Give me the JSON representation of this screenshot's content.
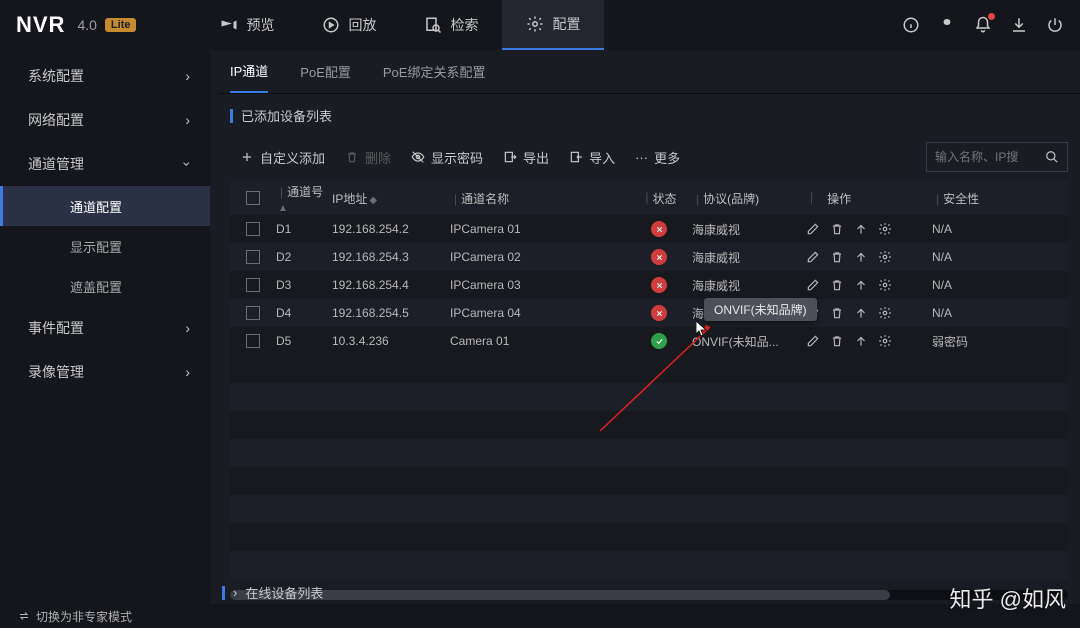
{
  "brand": {
    "name": "NVR",
    "version": "4.0",
    "edition": "Lite"
  },
  "mainnav": [
    {
      "label": "预览",
      "icon": "camera"
    },
    {
      "label": "回放",
      "icon": "playback"
    },
    {
      "label": "检索",
      "icon": "search-doc"
    },
    {
      "label": "配置",
      "icon": "gear",
      "active": true
    }
  ],
  "sidebar": [
    {
      "label": "系统配置",
      "expand": false
    },
    {
      "label": "网络配置",
      "expand": false
    },
    {
      "label": "通道管理",
      "expand": true,
      "children": [
        {
          "label": "通道配置",
          "active": true
        },
        {
          "label": "显示配置"
        },
        {
          "label": "遮盖配置"
        }
      ]
    },
    {
      "label": "事件配置",
      "expand": false
    },
    {
      "label": "录像管理",
      "expand": false
    }
  ],
  "subtabs": [
    {
      "label": "IP通道",
      "active": true
    },
    {
      "label": "PoE配置"
    },
    {
      "label": "PoE绑定关系配置"
    }
  ],
  "sections": {
    "added": "已添加设备列表",
    "online": "在线设备列表"
  },
  "toolbar": {
    "customAdd": "自定义添加",
    "delete": "删除",
    "showPwd": "显示密码",
    "export": "导出",
    "import": "导入",
    "more": "更多",
    "searchPlaceholder": "输入名称、IP搜"
  },
  "columns": {
    "channel": "通道号",
    "ip": "IP地址",
    "name": "通道名称",
    "status": "状态",
    "proto": "协议(品牌)",
    "ops": "操作",
    "sec": "安全性"
  },
  "rows": [
    {
      "ch": "D1",
      "ip": "192.168.254.2",
      "name": "IPCamera 01",
      "status": "err",
      "proto": "海康威视",
      "sec": "N/A"
    },
    {
      "ch": "D2",
      "ip": "192.168.254.3",
      "name": "IPCamera 02",
      "status": "err",
      "proto": "海康威视",
      "sec": "N/A"
    },
    {
      "ch": "D3",
      "ip": "192.168.254.4",
      "name": "IPCamera 03",
      "status": "err",
      "proto": "海康威视",
      "sec": "N/A"
    },
    {
      "ch": "D4",
      "ip": "192.168.254.5",
      "name": "IPCamera 04",
      "status": "err",
      "proto": "海",
      "sec": "N/A"
    },
    {
      "ch": "D5",
      "ip": "10.3.4.236",
      "name": "Camera 01",
      "status": "ok",
      "proto": "ONVIF(未知品...",
      "sec": "弱密码"
    }
  ],
  "tooltip": "ONVIF(未知品牌)",
  "footer": "切换为非专家模式",
  "watermark": "知乎 @如风"
}
